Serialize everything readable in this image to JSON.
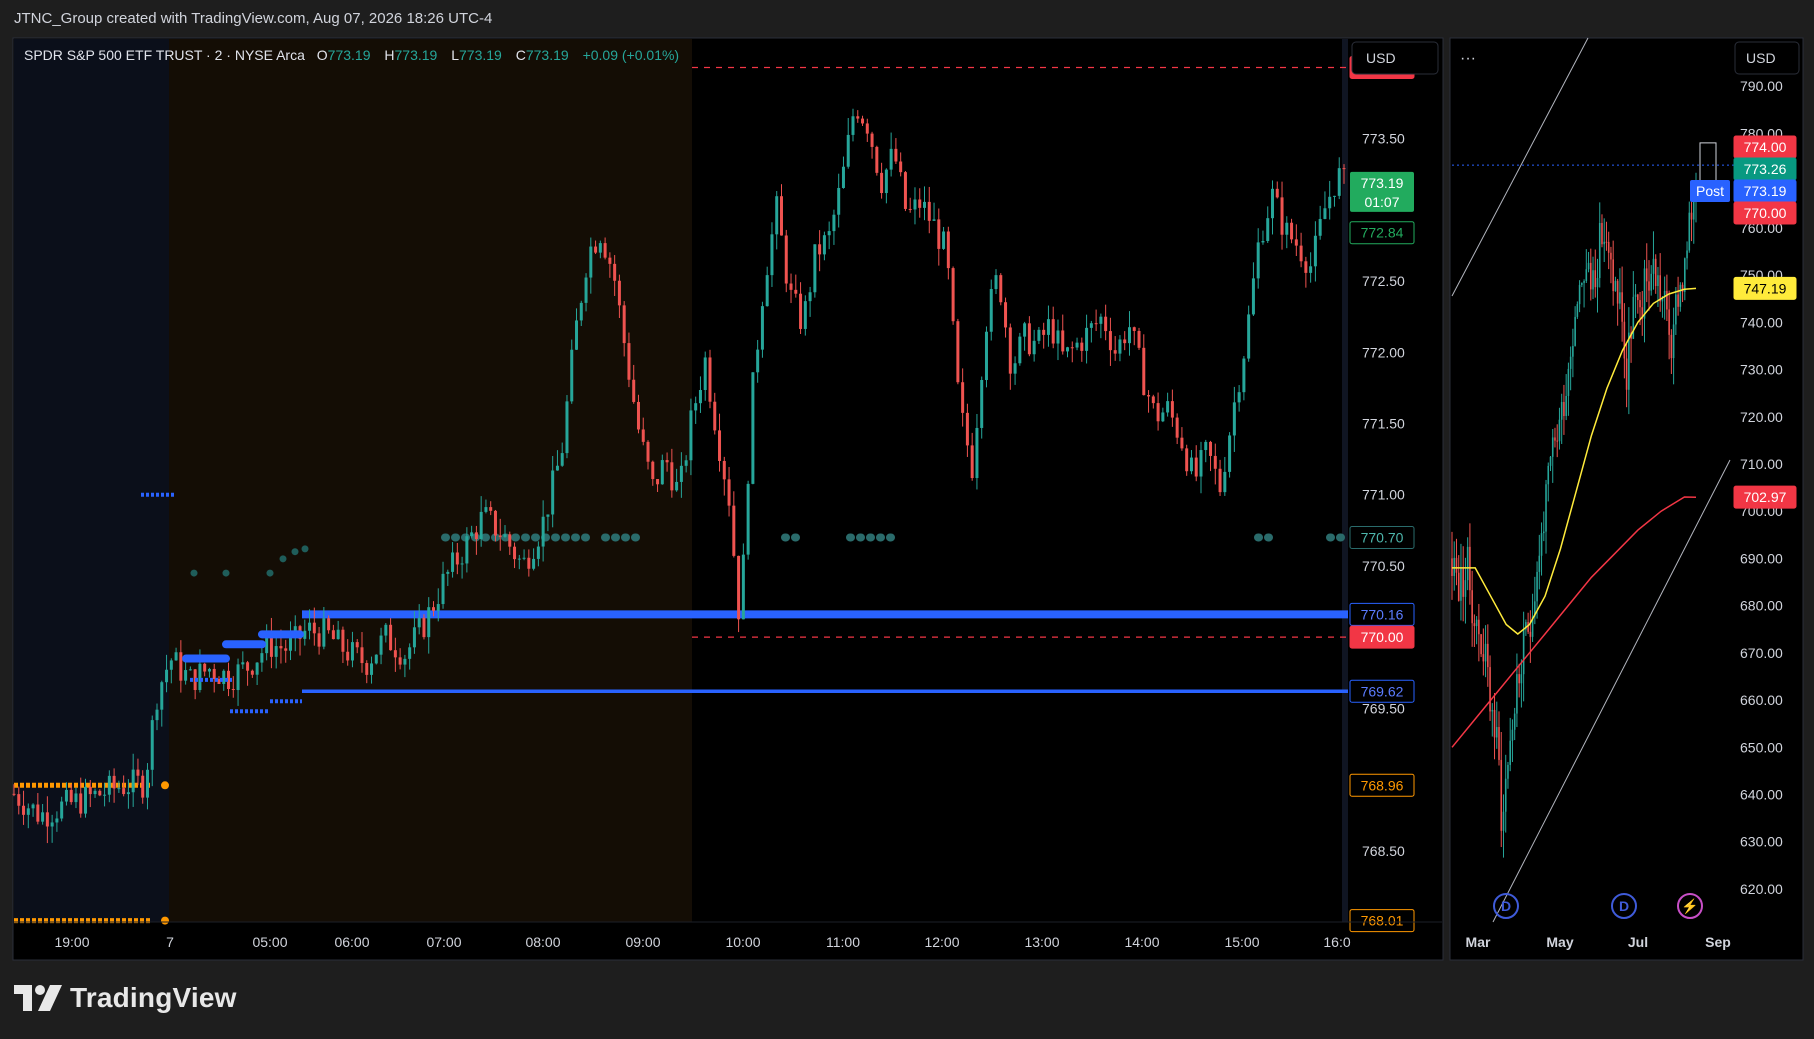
{
  "header": {
    "watermark": "JTNC_Group created with TradingView.com, Aug 07, 2026 18:26 UTC-4"
  },
  "brand": {
    "name": "TradingView"
  },
  "colors": {
    "up": "#26a69a",
    "down": "#ef5350",
    "blue": "#2962ff",
    "orange": "#ff9800",
    "teal_dots": "#2a6b6b",
    "sma_fast": "#ffeb3b",
    "sma_slow": "#f23645",
    "green_tag": "#22ab5e"
  },
  "main_chart": {
    "legend": {
      "symbol": "SPDR S&P 500 ETF TRUST · 2 · NYSE Arca",
      "o_label": "O",
      "o": "773.19",
      "h_label": "H",
      "h": "773.19",
      "l_label": "L",
      "l": "773.19",
      "c_label": "C",
      "c": "773.19",
      "change": "+0.09 (+0.01%)"
    },
    "currency": "USD"
  },
  "side_chart": {
    "menu": "···",
    "currency": "USD"
  },
  "chart_data": [
    {
      "type": "candlestick",
      "id": "intraday",
      "timeframe": "2 minute",
      "y_range": [
        768.0,
        774.2
      ],
      "y_ticks": [
        768.5,
        769.5,
        770.5,
        771.0,
        771.5,
        772.0,
        772.5,
        773.5
      ],
      "y_tick_labels": [
        "768.50",
        "769.50",
        "770.50",
        "771.00",
        "771.50",
        "772.00",
        "772.50",
        "773.50"
      ],
      "x_ticks": [
        "19:00",
        "7",
        "05:00",
        "06:00",
        "07:00",
        "08:00",
        "09:00",
        "10:00",
        "11:00",
        "12:00",
        "13:00",
        "14:00",
        "15:00",
        "16:0"
      ],
      "sessions": [
        "post-market",
        "pre-market",
        "regular"
      ],
      "close_path": [
        [
          0,
          768.9
        ],
        [
          4,
          768.75
        ],
        [
          8,
          768.82
        ],
        [
          12,
          768.88
        ],
        [
          16,
          768.95
        ],
        [
          20,
          768.98
        ],
        [
          22,
          769.62
        ],
        [
          24,
          769.85
        ],
        [
          27,
          769.7
        ],
        [
          30,
          769.78
        ],
        [
          33,
          769.72
        ],
        [
          36,
          769.8
        ],
        [
          39,
          769.95
        ],
        [
          42,
          769.92
        ],
        [
          45,
          770.05
        ],
        [
          48,
          770.02
        ],
        [
          51,
          769.9
        ],
        [
          54,
          769.82
        ],
        [
          57,
          770.0
        ],
        [
          60,
          769.88
        ],
        [
          63,
          770.1
        ],
        [
          66,
          770.4
        ],
        [
          69,
          770.62
        ],
        [
          72,
          770.85
        ],
        [
          75,
          770.72
        ],
        [
          78,
          770.5
        ],
        [
          81,
          770.78
        ],
        [
          84,
          771.3
        ],
        [
          86,
          772.1
        ],
        [
          88,
          772.7
        ],
        [
          90,
          772.85
        ],
        [
          92,
          772.55
        ],
        [
          94,
          771.95
        ],
        [
          96,
          771.4
        ],
        [
          98,
          771.05
        ],
        [
          100,
          771.25
        ],
        [
          102,
          771.0
        ],
        [
          104,
          771.55
        ],
        [
          106,
          771.95
        ],
        [
          108,
          771.4
        ],
        [
          110,
          770.9
        ],
        [
          111,
          770.15
        ],
        [
          112,
          770.55
        ],
        [
          113,
          771.6
        ],
        [
          115,
          772.5
        ],
        [
          117,
          773.0
        ],
        [
          119,
          772.4
        ],
        [
          121,
          772.2
        ],
        [
          123,
          772.7
        ],
        [
          125,
          772.8
        ],
        [
          127,
          773.2
        ],
        [
          129,
          773.75
        ],
        [
          131,
          773.6
        ],
        [
          133,
          773.2
        ],
        [
          135,
          773.4
        ],
        [
          137,
          772.95
        ],
        [
          139,
          773.05
        ],
        [
          141,
          772.9
        ],
        [
          143,
          772.7
        ],
        [
          145,
          771.6
        ],
        [
          147,
          771.2
        ],
        [
          149,
          772.2
        ],
        [
          151,
          772.55
        ],
        [
          153,
          771.9
        ],
        [
          155,
          772.1
        ],
        [
          157,
          772.05
        ],
        [
          159,
          772.2
        ],
        [
          161,
          771.95
        ],
        [
          163,
          772.05
        ],
        [
          165,
          772.15
        ],
        [
          167,
          772.25
        ],
        [
          169,
          772.0
        ],
        [
          171,
          772.2
        ],
        [
          173,
          771.85
        ],
        [
          175,
          771.55
        ],
        [
          177,
          771.6
        ],
        [
          179,
          771.4
        ],
        [
          181,
          771.1
        ],
        [
          183,
          771.3
        ],
        [
          185,
          771.05
        ],
        [
          187,
          771.6
        ],
        [
          189,
          772.1
        ],
        [
          191,
          772.8
        ],
        [
          193,
          773.1
        ],
        [
          195,
          772.85
        ],
        [
          197,
          772.75
        ],
        [
          199,
          772.6
        ],
        [
          201,
          773.0
        ],
        [
          203,
          773.25
        ],
        [
          204,
          773.19
        ]
      ],
      "levels": [
        {
          "value": 774.0,
          "label": "774.00",
          "style": "dashed-red"
        },
        {
          "value": 773.19,
          "label": "773.19",
          "style": "price-tag",
          "countdown": "01:07"
        },
        {
          "value": 772.84,
          "label": "772.84",
          "style": "green-outline"
        },
        {
          "value": 770.7,
          "label": "770.70",
          "style": "teal-dots"
        },
        {
          "value": 770.16,
          "label": "770.16",
          "style": "blue-thick"
        },
        {
          "value": 770.0,
          "label": "770.00",
          "style": "dashed-red"
        },
        {
          "value": 769.62,
          "label": "769.62",
          "style": "blue-thin"
        },
        {
          "value": 768.96,
          "label": "768.96",
          "style": "orange-dots"
        },
        {
          "value": 768.01,
          "label": "768.01",
          "style": "orange-dots"
        }
      ]
    },
    {
      "type": "candlestick",
      "id": "daily",
      "y_range": [
        615,
        795
      ],
      "y_ticks": [
        620,
        630,
        640,
        650,
        660,
        670,
        680,
        690,
        700,
        710,
        720,
        730,
        740,
        750,
        760,
        770,
        780,
        790
      ],
      "y_tick_labels": [
        "620.00",
        "630.00",
        "640.00",
        "650.00",
        "660.00",
        "670.00",
        "680.00",
        "690.00",
        "700.00",
        "710.00",
        "720.00",
        "730.00",
        "740.00",
        "750.00",
        "760.00",
        "",
        "780.00",
        "790.00"
      ],
      "x_ticks": [
        "Mar",
        "May",
        "Jul",
        "Sep"
      ],
      "event_markers": [
        "D",
        "D",
        "⚡"
      ],
      "close_path": [
        [
          0,
          690
        ],
        [
          2,
          684
        ],
        [
          4,
          688
        ],
        [
          6,
          676
        ],
        [
          8,
          672
        ],
        [
          10,
          660
        ],
        [
          12,
          648
        ],
        [
          13,
          632
        ],
        [
          14,
          645
        ],
        [
          16,
          658
        ],
        [
          18,
          668
        ],
        [
          20,
          676
        ],
        [
          22,
          688
        ],
        [
          24,
          700
        ],
        [
          26,
          712
        ],
        [
          28,
          720
        ],
        [
          30,
          730
        ],
        [
          32,
          745
        ],
        [
          34,
          752
        ],
        [
          36,
          748
        ],
        [
          38,
          756
        ],
        [
          39,
          760
        ],
        [
          40,
          754
        ],
        [
          42,
          748
        ],
        [
          44,
          742
        ],
        [
          45,
          725
        ],
        [
          46,
          738
        ],
        [
          47,
          745
        ],
        [
          48,
          740
        ],
        [
          50,
          748
        ],
        [
          52,
          752
        ],
        [
          54,
          746
        ],
        [
          56,
          740
        ],
        [
          57,
          732
        ],
        [
          58,
          746
        ],
        [
          60,
          750
        ],
        [
          62,
          764
        ],
        [
          63,
          773
        ]
      ],
      "series": [
        {
          "name": "",
          "color": "#ffeb3b",
          "points": [
            [
              0,
              688
            ],
            [
              6,
              688
            ],
            [
              10,
              682
            ],
            [
              14,
              676
            ],
            [
              17,
              674
            ],
            [
              20,
              676
            ],
            [
              24,
              682
            ],
            [
              28,
              692
            ],
            [
              32,
              704
            ],
            [
              36,
              716
            ],
            [
              40,
              726
            ],
            [
              44,
              734
            ],
            [
              48,
              740
            ],
            [
              52,
              744
            ],
            [
              56,
              746
            ],
            [
              60,
              747
            ],
            [
              63,
              747.19
            ]
          ]
        },
        {
          "name": "",
          "color": "#f23645",
          "points": [
            [
              0,
              650
            ],
            [
              6,
              656
            ],
            [
              12,
              662
            ],
            [
              18,
              668
            ],
            [
              24,
              674
            ],
            [
              30,
              680
            ],
            [
              36,
              686
            ],
            [
              42,
              691
            ],
            [
              48,
              696
            ],
            [
              54,
              700
            ],
            [
              60,
              703
            ],
            [
              63,
              702.97
            ]
          ]
        }
      ],
      "levels": [
        {
          "value": 774.0,
          "label": "774.00",
          "tag": "red"
        },
        {
          "value": 773.26,
          "label": "773.26",
          "tag": "green"
        },
        {
          "value": 773.19,
          "label": "773.19",
          "tag": "blue",
          "badge": "Post"
        },
        {
          "value": 770.0,
          "label": "770.00",
          "tag": "red"
        },
        {
          "value": 747.19,
          "label": "747.19",
          "tag": "yellow"
        },
        {
          "value": 702.97,
          "label": "702.97",
          "tag": "red"
        }
      ]
    }
  ]
}
